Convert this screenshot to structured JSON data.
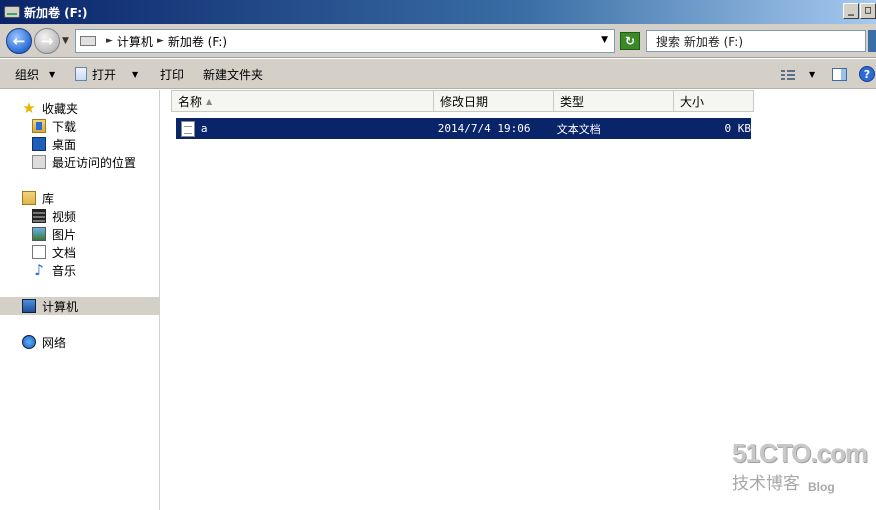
{
  "window": {
    "title": "新加卷 (F:)",
    "buttons": {
      "minimize": "_",
      "maximize": "□"
    }
  },
  "address_bar": {
    "crumbs": [
      "计算机",
      "新加卷 (F:)"
    ],
    "search_placeholder": "搜索 新加卷 (F:)"
  },
  "toolbar": {
    "organize": "组织",
    "open": "打开",
    "print": "打印",
    "new_folder": "新建文件夹"
  },
  "nav_pane": {
    "favorites": {
      "label": "收藏夹",
      "items": [
        "下载",
        "桌面",
        "最近访问的位置"
      ]
    },
    "libraries": {
      "label": "库",
      "items": [
        "视频",
        "图片",
        "文档",
        "音乐"
      ]
    },
    "computer": "计算机",
    "network": "网络"
  },
  "file_list": {
    "columns": [
      "名称",
      "修改日期",
      "类型",
      "大小"
    ],
    "sort_column": "名称",
    "rows": [
      {
        "name": "a",
        "modified": "2014/7/4 19:06",
        "type": "文本文档",
        "size": "0 KB",
        "selected": true
      }
    ]
  },
  "watermark": {
    "brand": "51CTO.com",
    "tagline": "技术博客",
    "blog": "Blog"
  },
  "icons": {
    "back": "back-arrow-icon",
    "forward": "forward-arrow-icon",
    "refresh": "refresh-icon",
    "views": "views-icon",
    "preview_pane": "preview-pane-icon",
    "help": "help-icon"
  }
}
